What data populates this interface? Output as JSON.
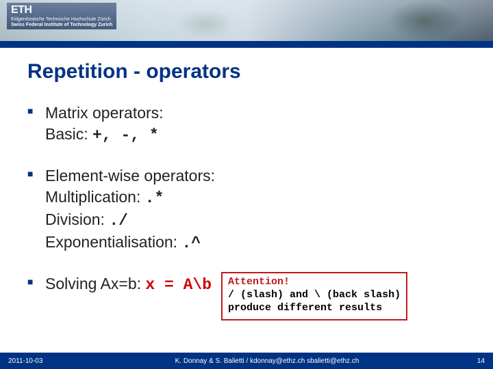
{
  "header": {
    "logo": "ETH",
    "sub1": "Eidgenössische Technische Hochschule Zürich",
    "sub2": "Swiss Federal Institute of Technology Zurich"
  },
  "title": "Repetition - operators",
  "bullets": {
    "matrix_label": "Matrix operators:",
    "matrix_basic_label": "Basic:",
    "matrix_basic_ops": "+, -, *",
    "element_label": "Element-wise operators:",
    "elem_mult_label": "Multiplication:",
    "elem_mult_op": ".*",
    "elem_div_label": "Division:",
    "elem_div_op": "./",
    "elem_exp_label": "Exponentialisation:",
    "elem_exp_op": ".^",
    "solve_label": "Solving Ax=b:",
    "solve_code": "x = A\\b"
  },
  "attention": {
    "header": "Attention!",
    "line1": "/ (slash) and \\ (back slash)",
    "line2": "produce different results"
  },
  "footer": {
    "date": "2011-10-03",
    "center": "K. Donnay & S. Balietti / kdonnay@ethz.ch  sbalietti@ethz.ch",
    "page": "14"
  }
}
